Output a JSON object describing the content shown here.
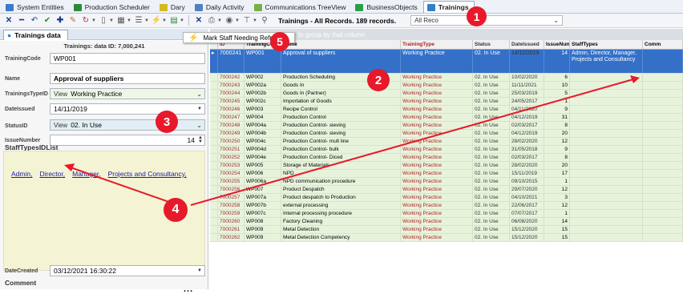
{
  "tabs": [
    {
      "label": "System Entities",
      "color": "#3d7ac8",
      "active": false
    },
    {
      "label": "Production Scheduler",
      "color": "#2a8a3a",
      "active": false
    },
    {
      "label": "Dary",
      "color": "#d8b820",
      "active": false
    },
    {
      "label": "Daily Activity",
      "color": "#5080c0",
      "active": false
    },
    {
      "label": "Communications TreeView",
      "color": "#78b048",
      "active": false
    },
    {
      "label": "BusinessObjects",
      "color": "#28a048",
      "active": false
    },
    {
      "label": "Trainings",
      "color": "#3080c8",
      "active": true
    }
  ],
  "toolbar": {
    "record_info": "Trainings - All Records. 189 records.",
    "filter_value": "All Reco",
    "icons": [
      "close-icon",
      "minus-icon",
      "undo-icon",
      "check-icon",
      "add-icon",
      "edit-icon",
      "refresh-icon",
      "doc-icon",
      "grid-icon",
      "list-icon",
      "lightning-icon",
      "export-icon",
      "close-icon",
      "print-icon",
      "stamp-icon",
      "filter-icon",
      "link-icon"
    ]
  },
  "menu": {
    "item": "Mark Staff Needing Refresh"
  },
  "left": {
    "tab": "Trainings data",
    "title": "Trainings: data ID: 7,000,241",
    "fields": {
      "training_code": {
        "label": "TrainingCode",
        "value": "WP001"
      },
      "name": {
        "label": "Name",
        "value": "Approval of suppliers"
      },
      "training_type": {
        "label": "TrainingsTypeID",
        "view": "View",
        "value": "Working Practice"
      },
      "date_issued": {
        "label": "DateIssued",
        "value": "14/11/2019"
      },
      "status": {
        "label": "StatusID",
        "view": "View",
        "value": "02. In Use"
      },
      "issue_number": {
        "label": "IssueNumber",
        "value": "14"
      },
      "date_created": {
        "label": "DateCreated",
        "value": "03/12/2021 16:30:22"
      }
    },
    "staff_types_header": "StaffTypesIDList",
    "staff_types": [
      "Admin,",
      "Director,",
      "Manager,",
      "Projects and Consultancy,"
    ],
    "comment_header": "Comment",
    "more": "..."
  },
  "grid": {
    "group_hint": "to group by that column",
    "columns": [
      "ID",
      "TrainingCode",
      "Name",
      "TrainingType",
      "Status",
      "DateIssued",
      "IssueNumber",
      "StaffTypes",
      "Comm"
    ],
    "selected": {
      "id": "7000241",
      "code": "WP001",
      "name": "Approval of suppliers",
      "type": "Working Practice",
      "status": "02. In Use",
      "date": "14/11/2019",
      "num": "14",
      "staff": "Admin, Director, Manager, Projects and Consultancy"
    },
    "rows": [
      [
        "7000242",
        "WP002",
        "Production Scheduling",
        "Working Practice",
        "02. In Use",
        "10/02/2020",
        "6"
      ],
      [
        "7000243",
        "WP002a",
        "Goods In",
        "Working Practice",
        "02. In Use",
        "11/11/2021",
        "10"
      ],
      [
        "7000244",
        "WP002b",
        "Goods In (Partner)",
        "Working Practice",
        "02. In Use",
        "25/03/2019",
        "5"
      ],
      [
        "7000245",
        "WP002c",
        "Importation of Goods",
        "Working Practice",
        "02. In Use",
        "24/05/2017",
        "1"
      ],
      [
        "7000246",
        "WP003",
        "Recipe Control",
        "Working Practice",
        "02. In Use",
        "04/11/2020",
        "9"
      ],
      [
        "7000247",
        "WP004",
        "Production Control",
        "Working Practice",
        "02. In Use",
        "04/12/2019",
        "31"
      ],
      [
        "7000248",
        "WP004a",
        "Production Control- sieving",
        "Working Practice",
        "02. In Use",
        "02/03/2017",
        "8"
      ],
      [
        "7000249",
        "WP004b",
        "Production Control- sieving",
        "Working Practice",
        "02. In Use",
        "04/12/2019",
        "20"
      ],
      [
        "7000250",
        "WP004c",
        "Production Control- mult line",
        "Working Practice",
        "02. In Use",
        "28/02/2020",
        "12"
      ],
      [
        "7000251",
        "WP004d",
        "Production Control- bulk",
        "Working Practice",
        "02. In Use",
        "31/05/2018",
        "9"
      ],
      [
        "7000252",
        "WP004e",
        "Production Control- Diced",
        "Working Practice",
        "02. In Use",
        "02/03/2017",
        "8"
      ],
      [
        "7000253",
        "WP005",
        "Storage of Materials",
        "Working Practice",
        "02. In Use",
        "28/02/2020",
        "20"
      ],
      [
        "7000254",
        "WP006",
        "NPD",
        "Working Practice",
        "02. In Use",
        "15/11/2019",
        "17"
      ],
      [
        "7000255",
        "WP006a",
        "NPD communication procedure",
        "Working Practice",
        "02. In Use",
        "09/10/2015",
        "1"
      ],
      [
        "7000256",
        "WP007",
        "Product Despatch",
        "Working Practice",
        "02. In Use",
        "29/07/2020",
        "12"
      ],
      [
        "7000257",
        "WP007a",
        "Product despatch to Production",
        "Working Practice",
        "02. In Use",
        "04/10/2021",
        "3"
      ],
      [
        "7000258",
        "WP007b",
        "external processing",
        "Working Practice",
        "02. In Use",
        "22/06/2017",
        "12"
      ],
      [
        "7000259",
        "WP007c",
        "Internal processing procedure",
        "Working Practice",
        "02. In Use",
        "07/07/2017",
        "1"
      ],
      [
        "7000260",
        "WP008",
        "Factory Cleaning",
        "Working Practice",
        "02. In Use",
        "06/08/2020",
        "14"
      ],
      [
        "7000261",
        "WP009",
        "Metal Detection",
        "Working Practice",
        "02. In Use",
        "15/12/2020",
        "15"
      ],
      [
        "7000262",
        "WP009",
        "Metal Detection Competency",
        "Working Practice",
        "02. In Use",
        "15/12/2020",
        "15"
      ]
    ]
  },
  "callouts": [
    "1",
    "2",
    "3",
    "4",
    "5"
  ],
  "colors": {
    "callout": "#e8192a",
    "selected_row": "#3470c8",
    "row_bg": "#e8f3dc"
  }
}
